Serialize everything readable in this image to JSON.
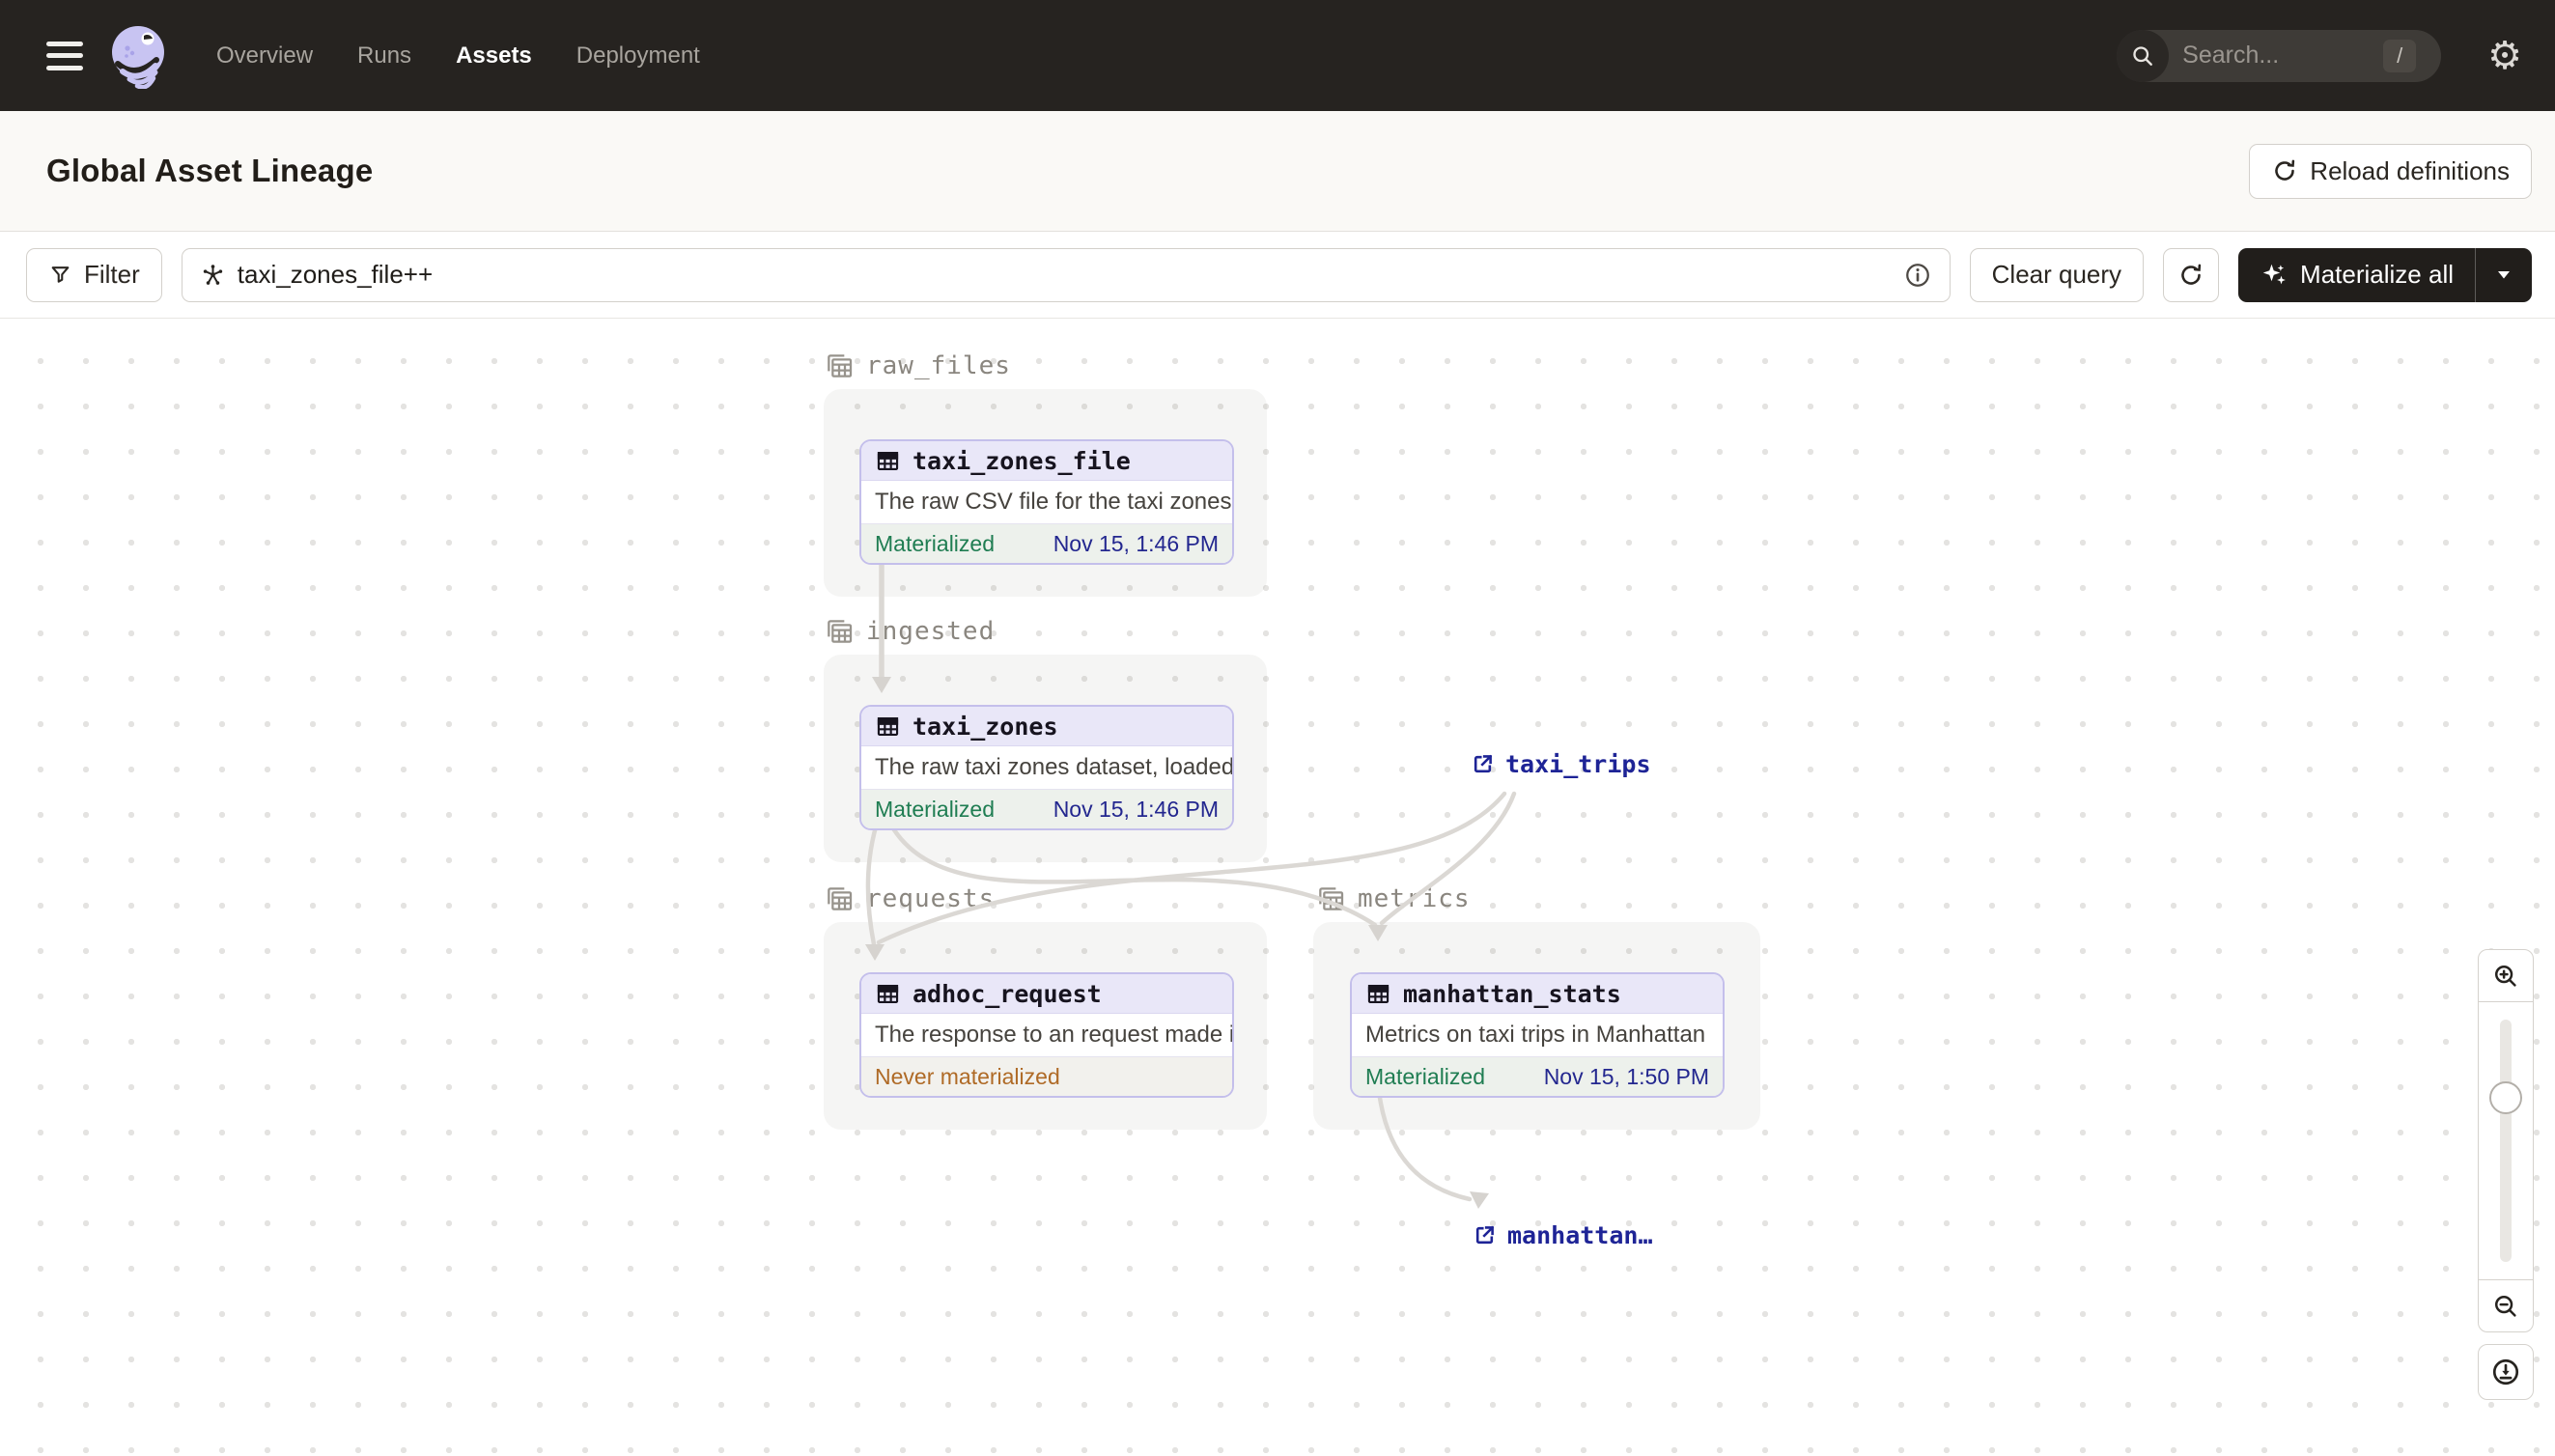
{
  "topbar": {
    "nav": [
      {
        "label": "Overview"
      },
      {
        "label": "Runs"
      },
      {
        "label": "Assets"
      },
      {
        "label": "Deployment"
      }
    ],
    "search": {
      "placeholder": "Search...",
      "shortcut": "/"
    }
  },
  "header": {
    "title": "Global Asset Lineage",
    "reload_label": "Reload definitions"
  },
  "toolbar": {
    "filter_label": "Filter",
    "query_value": "taxi_zones_file++",
    "clear_label": "Clear query",
    "materialize_label": "Materialize all"
  },
  "graph": {
    "groups": [
      {
        "name": "raw_files"
      },
      {
        "name": "ingested"
      },
      {
        "name": "requests"
      },
      {
        "name": "metrics"
      }
    ],
    "nodes": [
      {
        "title": "taxi_zones_file",
        "description": "The raw CSV file for the taxi zones dat...",
        "status": "Materialized",
        "timestamp": "Nov 15, 1:46 PM",
        "group": "raw_files"
      },
      {
        "title": "taxi_zones",
        "description": "The raw taxi zones dataset, loaded int...",
        "status": "Materialized",
        "timestamp": "Nov 15, 1:46 PM",
        "group": "ingested"
      },
      {
        "title": "adhoc_request",
        "description": "The response to an request made in th...",
        "status": "Never materialized",
        "timestamp": "",
        "group": "requests"
      },
      {
        "title": "manhattan_stats",
        "description": "Metrics on taxi trips in Manhattan",
        "status": "Materialized",
        "timestamp": "Nov 15, 1:50 PM",
        "group": "metrics"
      }
    ],
    "external_assets": [
      {
        "label": "taxi_trips"
      },
      {
        "label": "manhattan…"
      }
    ]
  },
  "colors": {
    "topbar_bg": "#262320",
    "node_border_lavender": "#c4bfeb",
    "node_header_lavender": "#e9e7f8",
    "materialized_green": "#1f7d52",
    "never_materialized_orange": "#af6a26",
    "timestamp_navy": "#23278f",
    "external_link_navy": "#1e2496",
    "edge_gray": "#dbd8d4"
  }
}
